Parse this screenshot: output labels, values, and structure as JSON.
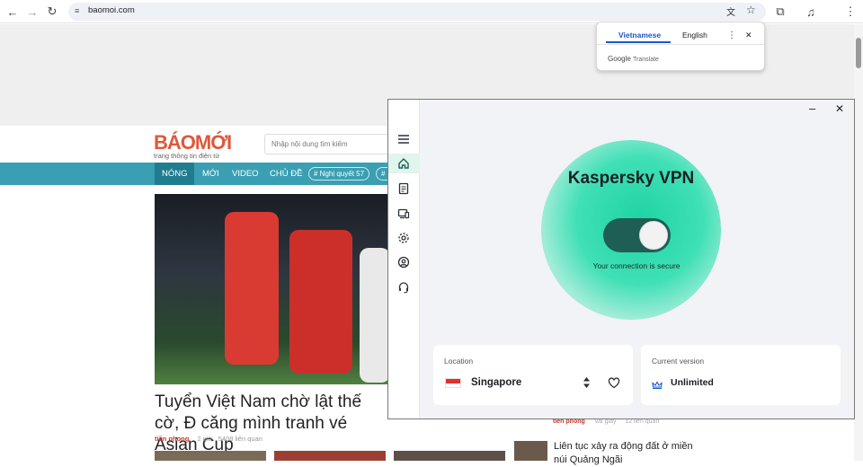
{
  "browser": {
    "url": "baomoi.com",
    "nav_back": "←",
    "nav_forward": "→",
    "nav_reload": "↻",
    "site_info_icon": "≡",
    "translate_icon": "文",
    "star_icon": "☆",
    "extensions_icon": "⧉",
    "media_icon": "♫",
    "menu_icon": "⋮"
  },
  "translate_popup": {
    "tab_source": "Vietnamese",
    "tab_target": "English",
    "more_icon": "⋮",
    "close_icon": "✕",
    "brand_google": "Google",
    "brand_translate": "Translate"
  },
  "site": {
    "logo": "BÁOMỚI",
    "tagline": "trang thông tin điện tử",
    "search_placeholder": "Nhập nội dung tìm kiếm",
    "nav": [
      "NÓNG",
      "MỚI",
      "VIDEO",
      "CHỦ ĐỀ"
    ],
    "tags": [
      "# Nghị quyết 57",
      "# "
    ],
    "headline": "Tuyển Việt Nam chờ lật thế cờ, Đ căng mình tranh vé Asian Cup",
    "meta_source": "tiền phong",
    "meta_time": "2 giờ",
    "meta_related": "5408 liên quan",
    "side_source": "tiền phong",
    "side_time": "vài giây",
    "side_related": "12 liên quan",
    "side_headline": "Liên tục xảy ra động đất ở miền núi Quảng Ngãi"
  },
  "vpn": {
    "title": "Kaspersky VPN",
    "status": "Your connection is secure",
    "connected": true,
    "minimize": "–",
    "close": "✕",
    "location_label": "Location",
    "location_value": "Singapore",
    "version_label": "Current version",
    "version_value": "Unlimited",
    "colors": {
      "accent": "#1fd3a3",
      "toggle": "#1e5e55"
    }
  }
}
